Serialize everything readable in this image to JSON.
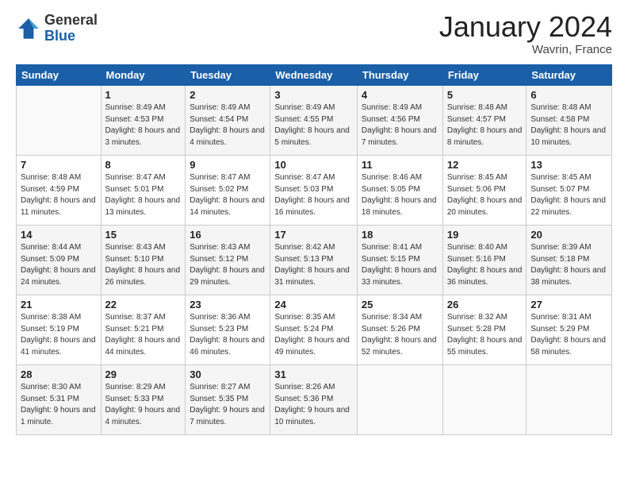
{
  "logo": {
    "general": "General",
    "blue": "Blue"
  },
  "header": {
    "title": "January 2024",
    "location": "Wavrin, France"
  },
  "columns": [
    "Sunday",
    "Monday",
    "Tuesday",
    "Wednesday",
    "Thursday",
    "Friday",
    "Saturday"
  ],
  "weeks": [
    [
      {
        "day": "",
        "sunrise": "",
        "sunset": "",
        "daylight": ""
      },
      {
        "day": "1",
        "sunrise": "Sunrise: 8:49 AM",
        "sunset": "Sunset: 4:53 PM",
        "daylight": "Daylight: 8 hours and 3 minutes."
      },
      {
        "day": "2",
        "sunrise": "Sunrise: 8:49 AM",
        "sunset": "Sunset: 4:54 PM",
        "daylight": "Daylight: 8 hours and 4 minutes."
      },
      {
        "day": "3",
        "sunrise": "Sunrise: 8:49 AM",
        "sunset": "Sunset: 4:55 PM",
        "daylight": "Daylight: 8 hours and 5 minutes."
      },
      {
        "day": "4",
        "sunrise": "Sunrise: 8:49 AM",
        "sunset": "Sunset: 4:56 PM",
        "daylight": "Daylight: 8 hours and 7 minutes."
      },
      {
        "day": "5",
        "sunrise": "Sunrise: 8:48 AM",
        "sunset": "Sunset: 4:57 PM",
        "daylight": "Daylight: 8 hours and 8 minutes."
      },
      {
        "day": "6",
        "sunrise": "Sunrise: 8:48 AM",
        "sunset": "Sunset: 4:58 PM",
        "daylight": "Daylight: 8 hours and 10 minutes."
      }
    ],
    [
      {
        "day": "7",
        "sunrise": "Sunrise: 8:48 AM",
        "sunset": "Sunset: 4:59 PM",
        "daylight": "Daylight: 8 hours and 11 minutes."
      },
      {
        "day": "8",
        "sunrise": "Sunrise: 8:47 AM",
        "sunset": "Sunset: 5:01 PM",
        "daylight": "Daylight: 8 hours and 13 minutes."
      },
      {
        "day": "9",
        "sunrise": "Sunrise: 8:47 AM",
        "sunset": "Sunset: 5:02 PM",
        "daylight": "Daylight: 8 hours and 14 minutes."
      },
      {
        "day": "10",
        "sunrise": "Sunrise: 8:47 AM",
        "sunset": "Sunset: 5:03 PM",
        "daylight": "Daylight: 8 hours and 16 minutes."
      },
      {
        "day": "11",
        "sunrise": "Sunrise: 8:46 AM",
        "sunset": "Sunset: 5:05 PM",
        "daylight": "Daylight: 8 hours and 18 minutes."
      },
      {
        "day": "12",
        "sunrise": "Sunrise: 8:45 AM",
        "sunset": "Sunset: 5:06 PM",
        "daylight": "Daylight: 8 hours and 20 minutes."
      },
      {
        "day": "13",
        "sunrise": "Sunrise: 8:45 AM",
        "sunset": "Sunset: 5:07 PM",
        "daylight": "Daylight: 8 hours and 22 minutes."
      }
    ],
    [
      {
        "day": "14",
        "sunrise": "Sunrise: 8:44 AM",
        "sunset": "Sunset: 5:09 PM",
        "daylight": "Daylight: 8 hours and 24 minutes."
      },
      {
        "day": "15",
        "sunrise": "Sunrise: 8:43 AM",
        "sunset": "Sunset: 5:10 PM",
        "daylight": "Daylight: 8 hours and 26 minutes."
      },
      {
        "day": "16",
        "sunrise": "Sunrise: 8:43 AM",
        "sunset": "Sunset: 5:12 PM",
        "daylight": "Daylight: 8 hours and 29 minutes."
      },
      {
        "day": "17",
        "sunrise": "Sunrise: 8:42 AM",
        "sunset": "Sunset: 5:13 PM",
        "daylight": "Daylight: 8 hours and 31 minutes."
      },
      {
        "day": "18",
        "sunrise": "Sunrise: 8:41 AM",
        "sunset": "Sunset: 5:15 PM",
        "daylight": "Daylight: 8 hours and 33 minutes."
      },
      {
        "day": "19",
        "sunrise": "Sunrise: 8:40 AM",
        "sunset": "Sunset: 5:16 PM",
        "daylight": "Daylight: 8 hours and 36 minutes."
      },
      {
        "day": "20",
        "sunrise": "Sunrise: 8:39 AM",
        "sunset": "Sunset: 5:18 PM",
        "daylight": "Daylight: 8 hours and 38 minutes."
      }
    ],
    [
      {
        "day": "21",
        "sunrise": "Sunrise: 8:38 AM",
        "sunset": "Sunset: 5:19 PM",
        "daylight": "Daylight: 8 hours and 41 minutes."
      },
      {
        "day": "22",
        "sunrise": "Sunrise: 8:37 AM",
        "sunset": "Sunset: 5:21 PM",
        "daylight": "Daylight: 8 hours and 44 minutes."
      },
      {
        "day": "23",
        "sunrise": "Sunrise: 8:36 AM",
        "sunset": "Sunset: 5:23 PM",
        "daylight": "Daylight: 8 hours and 46 minutes."
      },
      {
        "day": "24",
        "sunrise": "Sunrise: 8:35 AM",
        "sunset": "Sunset: 5:24 PM",
        "daylight": "Daylight: 8 hours and 49 minutes."
      },
      {
        "day": "25",
        "sunrise": "Sunrise: 8:34 AM",
        "sunset": "Sunset: 5:26 PM",
        "daylight": "Daylight: 8 hours and 52 minutes."
      },
      {
        "day": "26",
        "sunrise": "Sunrise: 8:32 AM",
        "sunset": "Sunset: 5:28 PM",
        "daylight": "Daylight: 8 hours and 55 minutes."
      },
      {
        "day": "27",
        "sunrise": "Sunrise: 8:31 AM",
        "sunset": "Sunset: 5:29 PM",
        "daylight": "Daylight: 8 hours and 58 minutes."
      }
    ],
    [
      {
        "day": "28",
        "sunrise": "Sunrise: 8:30 AM",
        "sunset": "Sunset: 5:31 PM",
        "daylight": "Daylight: 9 hours and 1 minute."
      },
      {
        "day": "29",
        "sunrise": "Sunrise: 8:29 AM",
        "sunset": "Sunset: 5:33 PM",
        "daylight": "Daylight: 9 hours and 4 minutes."
      },
      {
        "day": "30",
        "sunrise": "Sunrise: 8:27 AM",
        "sunset": "Sunset: 5:35 PM",
        "daylight": "Daylight: 9 hours and 7 minutes."
      },
      {
        "day": "31",
        "sunrise": "Sunrise: 8:26 AM",
        "sunset": "Sunset: 5:36 PM",
        "daylight": "Daylight: 9 hours and 10 minutes."
      },
      {
        "day": "",
        "sunrise": "",
        "sunset": "",
        "daylight": ""
      },
      {
        "day": "",
        "sunrise": "",
        "sunset": "",
        "daylight": ""
      },
      {
        "day": "",
        "sunrise": "",
        "sunset": "",
        "daylight": ""
      }
    ]
  ]
}
